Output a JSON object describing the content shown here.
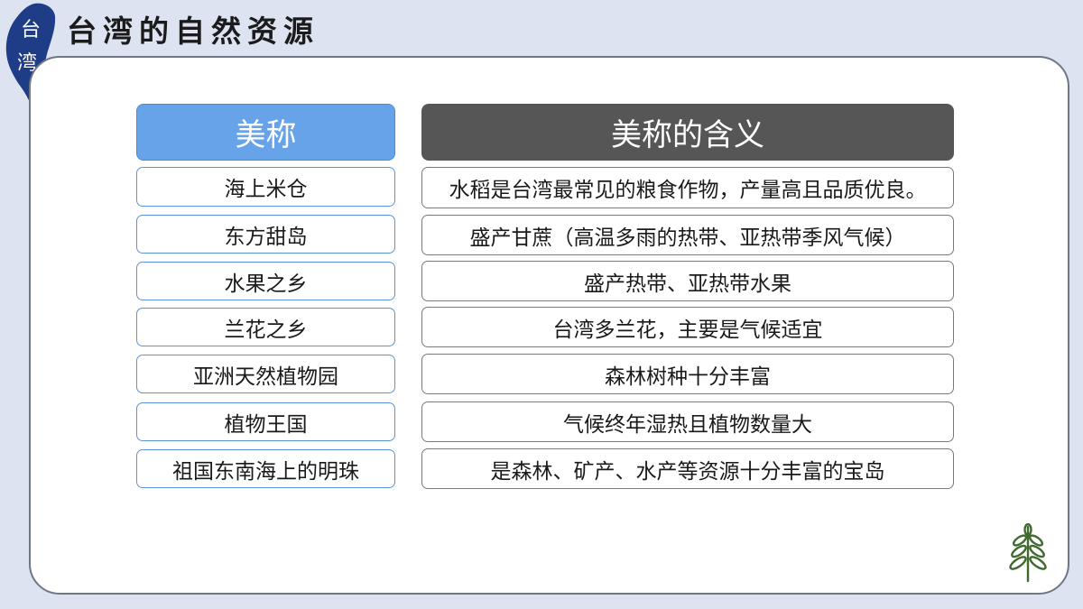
{
  "title": "台湾的自然资源",
  "logo": {
    "char1": "台",
    "char2": "湾",
    "icon": "taiwan-map-icon"
  },
  "table": {
    "header_name": "美称",
    "header_meaning": "美称的含义",
    "rows": [
      {
        "name": "海上米仓",
        "meaning": "水稻是台湾最常见的粮食作物，产量高且品质优良。"
      },
      {
        "name": "东方甜岛",
        "meaning": "盛产甘蔗（高温多雨的热带、亚热带季风气候）"
      },
      {
        "name": "水果之乡",
        "meaning": "盛产热带、亚热带水果"
      },
      {
        "name": "兰花之乡",
        "meaning": "台湾多兰花，主要是气候适宜"
      },
      {
        "name": "亚洲天然植物园",
        "meaning": "森林树种十分丰富"
      },
      {
        "name": "植物王国",
        "meaning": "气候终年湿热且植物数量大"
      },
      {
        "name": "祖国东南海上的明珠",
        "meaning": "是森林、矿产、水产等资源十分丰富的宝岛"
      }
    ]
  },
  "decor": {
    "plant_icon": "leaf-sprig-icon",
    "accent": "#66a3e9",
    "dark_header": "#565656",
    "plant_color": "#3f6a2d"
  }
}
